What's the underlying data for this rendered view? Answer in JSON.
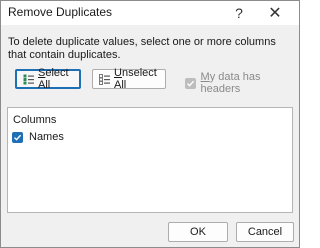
{
  "window": {
    "title": "Remove Duplicates",
    "help_glyph": "?",
    "close_glyph": "✕"
  },
  "description": "To delete duplicate values, select one or more columns that contain duplicates.",
  "buttons": {
    "select_all": {
      "access_key": "S",
      "rest": "elect All",
      "icon": "select-all-icon"
    },
    "unselect_all": {
      "access_key": "U",
      "rest": "nselect All",
      "icon": "unselect-all-icon"
    },
    "ok": "OK",
    "cancel": "Cancel"
  },
  "headers_option": {
    "access_key": "M",
    "rest": "y data has headers",
    "checked": true,
    "enabled": false
  },
  "columns": {
    "header": "Columns",
    "items": [
      {
        "label": "Names",
        "checked": true
      }
    ]
  },
  "colors": {
    "accent": "#1f6fb5",
    "disabled": "#bdbdbd"
  }
}
